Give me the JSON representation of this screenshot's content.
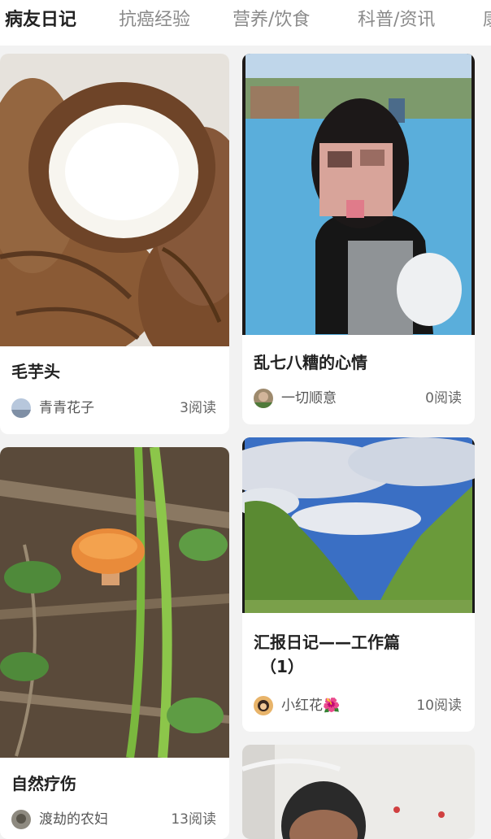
{
  "tabs": [
    "病友日记",
    "抗癌经验",
    "营养/饮食",
    "科普/资讯",
    "康"
  ],
  "posts": [
    {
      "title": "毛芋头",
      "author": "青青花子",
      "reads": "3阅读"
    },
    {
      "title": "乱七八糟的心情",
      "author": "一切顺意",
      "reads": "0阅读"
    },
    {
      "title": "自然疗伤",
      "author": "渡劫的农妇",
      "reads": "13阅读"
    },
    {
      "title": "汇报日记——工作篇",
      "title2": "（1）",
      "author": "小红花🌺",
      "reads": "10阅读"
    }
  ],
  "colors": {
    "background": "#f2f2f2",
    "active_tab": "#222222",
    "inactive_tab": "#8a8a8a"
  }
}
